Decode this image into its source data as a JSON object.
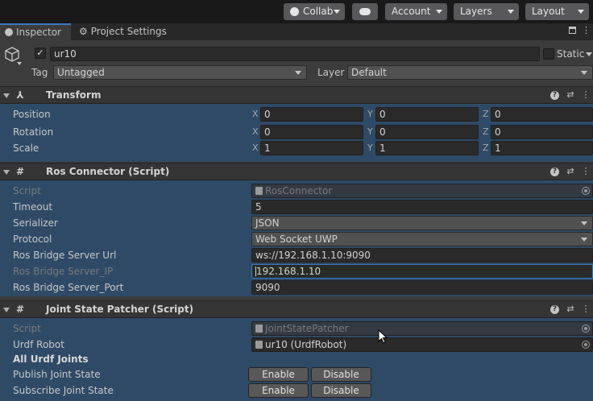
{
  "toolbar": {
    "collab_label": "Collab",
    "account_label": "Account",
    "layers_label": "Layers",
    "layout_label": "Layout"
  },
  "tabs": {
    "inspector": "Inspector",
    "project_settings": "Project Settings"
  },
  "gameobject": {
    "name": "ur10",
    "static_label": "Static",
    "tag_label": "Tag",
    "tag_value": "Untagged",
    "layer_label": "Layer",
    "layer_value": "Default"
  },
  "transform": {
    "title": "Transform",
    "rows": [
      {
        "label": "Position",
        "x": "0",
        "y": "0",
        "z": "0"
      },
      {
        "label": "Rotation",
        "x": "0",
        "y": "0",
        "z": "0"
      },
      {
        "label": "Scale",
        "x": "1",
        "y": "1",
        "z": "1"
      }
    ],
    "axis_x": "X",
    "axis_y": "Y",
    "axis_z": "Z"
  },
  "ros_connector": {
    "title": "Ros Connector (Script)",
    "script_label": "Script",
    "script_value": "RosConnector",
    "timeout_label": "Timeout",
    "timeout_value": "5",
    "serializer_label": "Serializer",
    "serializer_value": "JSON",
    "protocol_label": "Protocol",
    "protocol_value": "Web Socket UWP",
    "url_label": "Ros Bridge Server Url",
    "url_value": "ws://192.168.1.10:9090",
    "ip_label": "Ros Bridge Server_IP",
    "ip_value": "192.168.1.10",
    "port_label": "Ros Bridge Server_Port",
    "port_value": "9090"
  },
  "joint_state": {
    "title": "Joint State Patcher (Script)",
    "script_label": "Script",
    "script_value": "JointStatePatcher",
    "robot_label": "Urdf Robot",
    "robot_value": "ur10 (UrdfRobot)",
    "all_joints_label": "All Urdf Joints",
    "publish_label": "Publish Joint State",
    "subscribe_label": "Subscribe Joint State",
    "enable_label": "Enable",
    "disable_label": "Disable"
  },
  "colors": {
    "accent": "#3a79bb",
    "selection_bg": "#2e4a66"
  }
}
